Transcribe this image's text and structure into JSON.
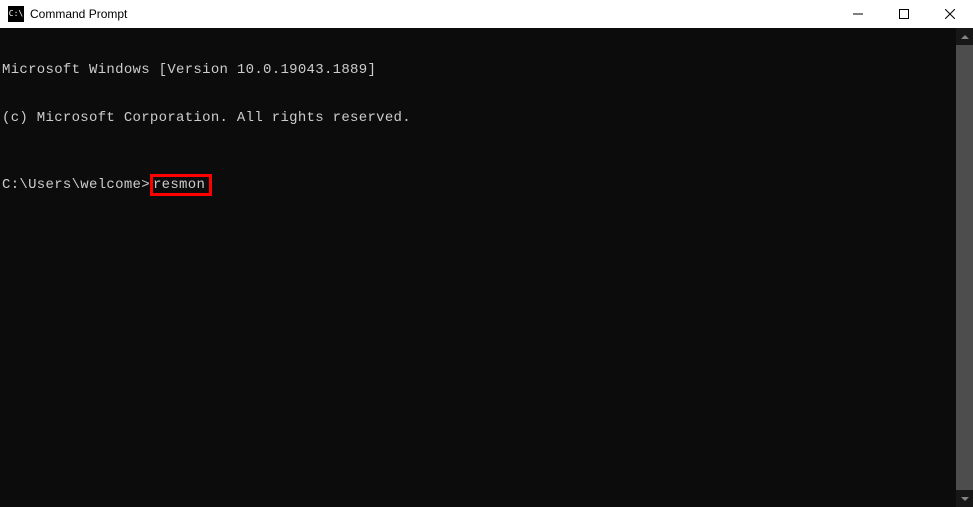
{
  "window": {
    "title": "Command Prompt",
    "icon_text": "C:\\"
  },
  "terminal": {
    "line1": "Microsoft Windows [Version 10.0.19043.1889]",
    "line2": "(c) Microsoft Corporation. All rights reserved.",
    "prompt": "C:\\Users\\welcome>",
    "command": "resmon"
  }
}
